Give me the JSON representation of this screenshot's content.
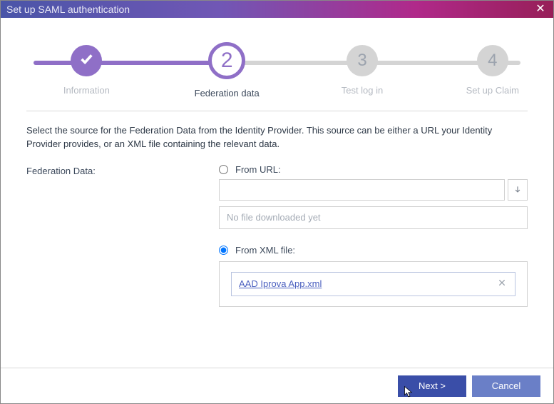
{
  "window": {
    "title": "Set up SAML authentication"
  },
  "steps": {
    "s1": {
      "label": "Information"
    },
    "s2": {
      "num": "2",
      "label": "Federation data"
    },
    "s3": {
      "num": "3",
      "label": "Test log in"
    },
    "s4": {
      "num": "4",
      "label": "Set up Claim"
    }
  },
  "instruction": "Select the source for the Federation Data from the Identity Provider. This source can be either a URL your Identity Provider provides, or an XML file containing the relevant data.",
  "form": {
    "section_label": "Federation Data:",
    "from_url_label": "From URL:",
    "url_value": "",
    "url_status": "No file downloaded yet",
    "from_xml_label": "From XML file:",
    "file_name": "AAD Iprova App.xml",
    "selected_source": "xml"
  },
  "buttons": {
    "next": "Next >",
    "cancel": "Cancel"
  }
}
